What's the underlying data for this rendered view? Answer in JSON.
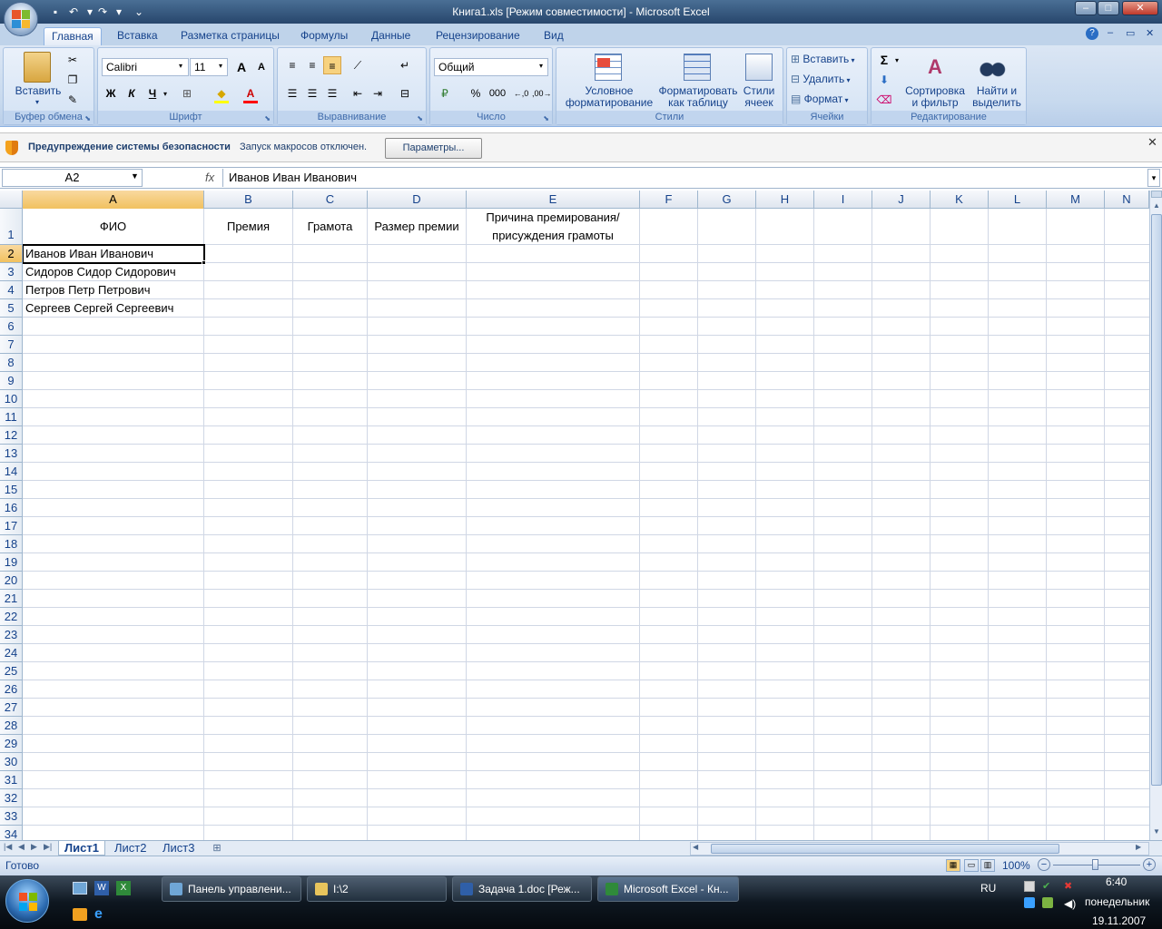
{
  "window": {
    "title": "Книга1.xls  [Режим совместимости] - Microsoft Excel",
    "min": "–",
    "max": "□",
    "close": "✕"
  },
  "tabs": [
    "Главная",
    "Вставка",
    "Разметка страницы",
    "Формулы",
    "Данные",
    "Рецензирование",
    "Вид"
  ],
  "ribbon": {
    "clipboard": {
      "label": "Буфер обмена",
      "paste": "Вставить"
    },
    "font": {
      "label": "Шрифт",
      "name": "Calibri",
      "size": "11",
      "bold": "Ж",
      "italic": "К",
      "underline": "Ч"
    },
    "alignment": {
      "label": "Выравнивание"
    },
    "number": {
      "label": "Число",
      "format": "Общий",
      "percent": "%",
      "thousands": "000"
    },
    "styles": {
      "label": "Стили",
      "cond1": "Условное",
      "cond2": "форматирование",
      "tbl1": "Форматировать",
      "tbl2": "как таблицу",
      "cs1": "Стили",
      "cs2": "ячеек"
    },
    "cells": {
      "label": "Ячейки",
      "insert": "Вставить",
      "delete": "Удалить",
      "format": "Формат"
    },
    "editing": {
      "label": "Редактирование",
      "sigma": "Σ",
      "sort1": "Сортировка",
      "sort2": "и фильтр",
      "find1": "Найти и",
      "find2": "выделить"
    }
  },
  "security": {
    "title": "Предупреждение системы безопасности",
    "message": "Запуск макросов отключен.",
    "button": "Параметры...",
    "close": "✕"
  },
  "formula": {
    "namebox": "A2",
    "fx": "fx",
    "value": "Иванов Иван Иванович"
  },
  "grid": {
    "columns": [
      "A",
      "B",
      "C",
      "D",
      "E",
      "F",
      "G",
      "H",
      "I",
      "J",
      "K",
      "L",
      "M",
      "N"
    ],
    "rows": [
      "1",
      "2",
      "3",
      "4",
      "5",
      "6",
      "7",
      "8",
      "9",
      "10",
      "11",
      "12",
      "13",
      "14",
      "15",
      "16",
      "17",
      "18",
      "19",
      "20",
      "21",
      "22",
      "23",
      "24",
      "25",
      "26",
      "27",
      "28",
      "29",
      "30",
      "31",
      "32",
      "33",
      "34"
    ],
    "header": {
      "a": "ФИО",
      "b": "Премия",
      "c": "Грамота",
      "d": "Размер премии",
      "e1": "Причина премирования/",
      "e2": "присуждения грамоты"
    },
    "names": [
      "Иванов Иван Иванович",
      "Сидоров Сидор Сидорович",
      "Петров Петр Петрович",
      "Сергеев Сергей Сергеевич"
    ]
  },
  "sheets": [
    "Лист1",
    "Лист2",
    "Лист3"
  ],
  "status": {
    "ready": "Готово",
    "zoom": "100%"
  },
  "taskbar": {
    "items": [
      "Панель управлени...",
      "I:\\2",
      "Задача 1.doc [Реж...",
      "Microsoft Excel - Кн..."
    ],
    "lang": "RU",
    "time": "6:40",
    "day": "понедельник",
    "date": "19.11.2007"
  },
  "colors": {
    "accent": "#15428b",
    "selection": "#f1c15f",
    "ribbon": "#c7d9ee"
  }
}
